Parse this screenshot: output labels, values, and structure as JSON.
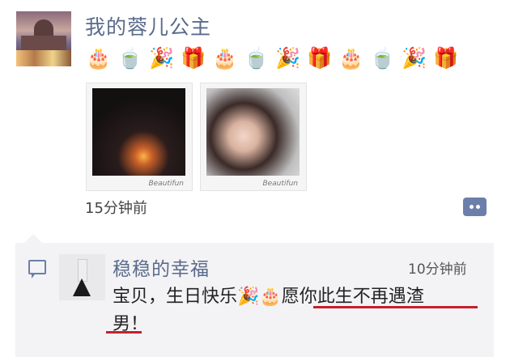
{
  "post": {
    "author": "我的蓉儿公主",
    "emojis": [
      "🎂",
      "🍵",
      "🎉",
      "🎁",
      "🎂",
      "🍵",
      "🎉",
      "🎁",
      "🎂",
      "🍵",
      "🎉",
      "🎁"
    ],
    "photo_signature": "Beautifun",
    "time": "15分钟前"
  },
  "comment": {
    "author": "稳稳的幸福",
    "time": "10分钟前",
    "text_line1": "宝贝，生日快乐🎉🎂愿你此生不再遇渣",
    "text_line2": "男！"
  },
  "colors": {
    "link": "#5a6b8c",
    "highlight_underline": "#c4202d",
    "comment_bg": "#f3f3f5"
  }
}
